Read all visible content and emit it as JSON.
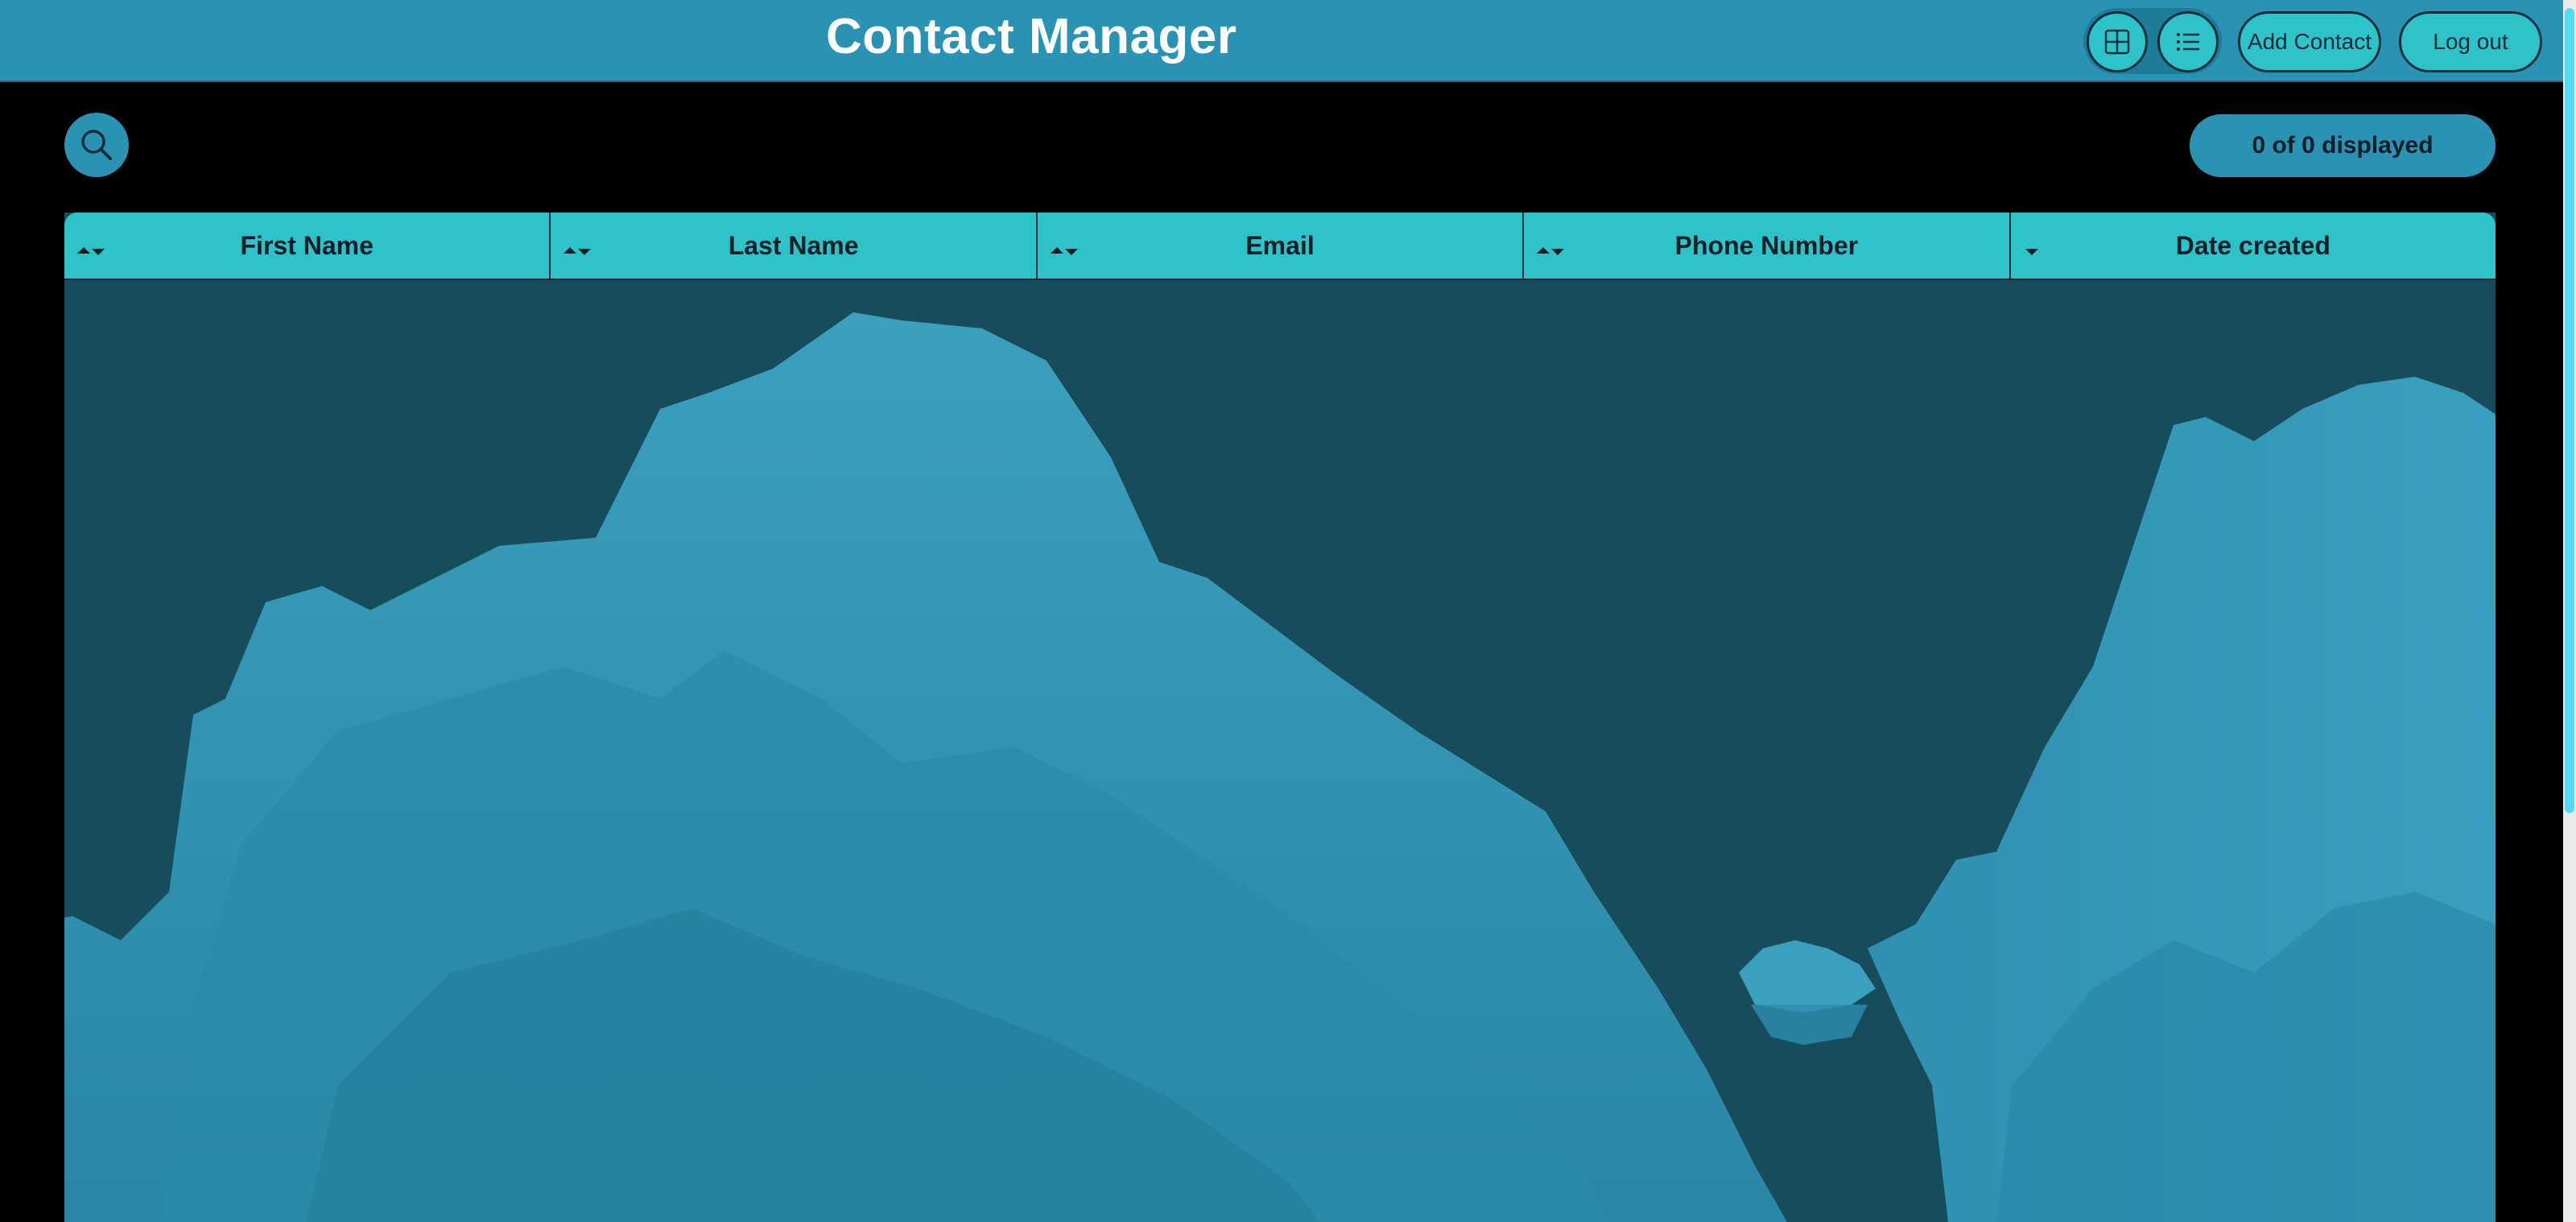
{
  "header": {
    "title": "Contact Manager",
    "add_label": "Add Contact",
    "logout_label": "Log out",
    "grid_icon": "grid-icon",
    "list_icon": "list-icon"
  },
  "toolbar": {
    "search_icon": "search-icon",
    "count_text": "0 of 0 displayed"
  },
  "table": {
    "columns": [
      {
        "label": "First Name",
        "sort": "both"
      },
      {
        "label": "Last Name",
        "sort": "both"
      },
      {
        "label": "Email",
        "sort": "both"
      },
      {
        "label": "Phone Number",
        "sort": "both"
      },
      {
        "label": "Date created",
        "sort": "desc"
      }
    ],
    "rows": []
  },
  "colors": {
    "header_bg": "#2a93b4",
    "accent": "#2ec3c9",
    "table_bg": "#164c5c",
    "page_bg": "#000000"
  }
}
